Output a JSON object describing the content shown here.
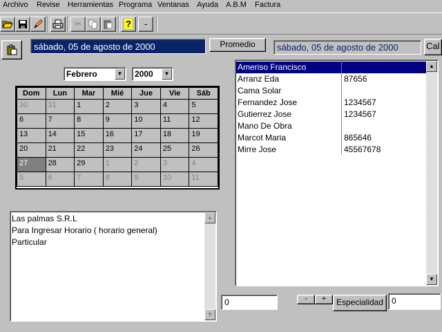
{
  "menu": [
    "Archivo",
    "Revise",
    "Herramientas",
    "Programa",
    "Ventanas",
    "Ayuda",
    "A.B.M",
    "Factura"
  ],
  "toolbar": {
    "open_icon": "folder-open-icon",
    "save_icon": "floppy-disk-icon",
    "edit_icon": "pencil-icon",
    "print_icon": "printer-icon",
    "cut_icon": "scissors-icon",
    "copy_icon": "copy-icon",
    "paste_icon": "paste-icon",
    "help_label": "?",
    "minus_label": "-"
  },
  "header": {
    "date_text": "sábado, 05 de agosto de 2000",
    "promedio_label": "Promedio",
    "date_text_right": "sábado, 05 de agosto de 2000",
    "cal_button_label": "Cal"
  },
  "calendar": {
    "month": "Febrero",
    "year": "2000",
    "weekdays": [
      "Dom",
      "Lun",
      "Mar",
      "Mié",
      "Jue",
      "Vie",
      "Sáb"
    ],
    "weeks": [
      [
        {
          "d": "30",
          "out": true
        },
        {
          "d": "31",
          "out": true
        },
        {
          "d": "1"
        },
        {
          "d": "2"
        },
        {
          "d": "3"
        },
        {
          "d": "4"
        },
        {
          "d": "5"
        }
      ],
      [
        {
          "d": "6"
        },
        {
          "d": "7"
        },
        {
          "d": "8"
        },
        {
          "d": "9"
        },
        {
          "d": "10"
        },
        {
          "d": "11"
        },
        {
          "d": "12"
        }
      ],
      [
        {
          "d": "13"
        },
        {
          "d": "14"
        },
        {
          "d": "15"
        },
        {
          "d": "16"
        },
        {
          "d": "17"
        },
        {
          "d": "18"
        },
        {
          "d": "19"
        }
      ],
      [
        {
          "d": "20"
        },
        {
          "d": "21"
        },
        {
          "d": "22"
        },
        {
          "d": "23"
        },
        {
          "d": "24"
        },
        {
          "d": "25"
        },
        {
          "d": "26"
        }
      ],
      [
        {
          "d": "27",
          "selected": true
        },
        {
          "d": "28"
        },
        {
          "d": "29"
        },
        {
          "d": "1",
          "out": true
        },
        {
          "d": "2",
          "out": true
        },
        {
          "d": "3",
          "out": true
        },
        {
          "d": "4",
          "out": true
        }
      ],
      [
        {
          "d": "5",
          "out": true
        },
        {
          "d": "6",
          "out": true
        },
        {
          "d": "7",
          "out": true
        },
        {
          "d": "8",
          "out": true
        },
        {
          "d": "9",
          "out": true
        },
        {
          "d": "10",
          "out": true
        },
        {
          "d": "11",
          "out": true
        }
      ]
    ]
  },
  "notes_list": [
    "Las palmas S.R.L",
    "Para Ingresar Horario ( horario general)",
    "Particular"
  ],
  "people_list": [
    {
      "name": "Ameriso Francisco",
      "value": "",
      "selected": true
    },
    {
      "name": "Arranz Eda",
      "value": "87656"
    },
    {
      "name": "Cama Solar",
      "value": ""
    },
    {
      "name": "Fernandez Jose",
      "value": "1234567"
    },
    {
      "name": "Gutierrez Jose",
      "value": "1234567"
    },
    {
      "name": "Mano De Obra",
      "value": ""
    },
    {
      "name": "Marcot Maria",
      "value": "865646"
    },
    {
      "name": "Mirre Jose",
      "value": "45567678"
    }
  ],
  "bottom": {
    "left_value": "0",
    "minus_label": "-",
    "plus_label": "+",
    "especialidad_label": "Especialidad",
    "right_value": "0"
  },
  "colors": {
    "selection": "#000080",
    "face": "#c0c0c0",
    "date_field_bg": "#0a246a"
  }
}
